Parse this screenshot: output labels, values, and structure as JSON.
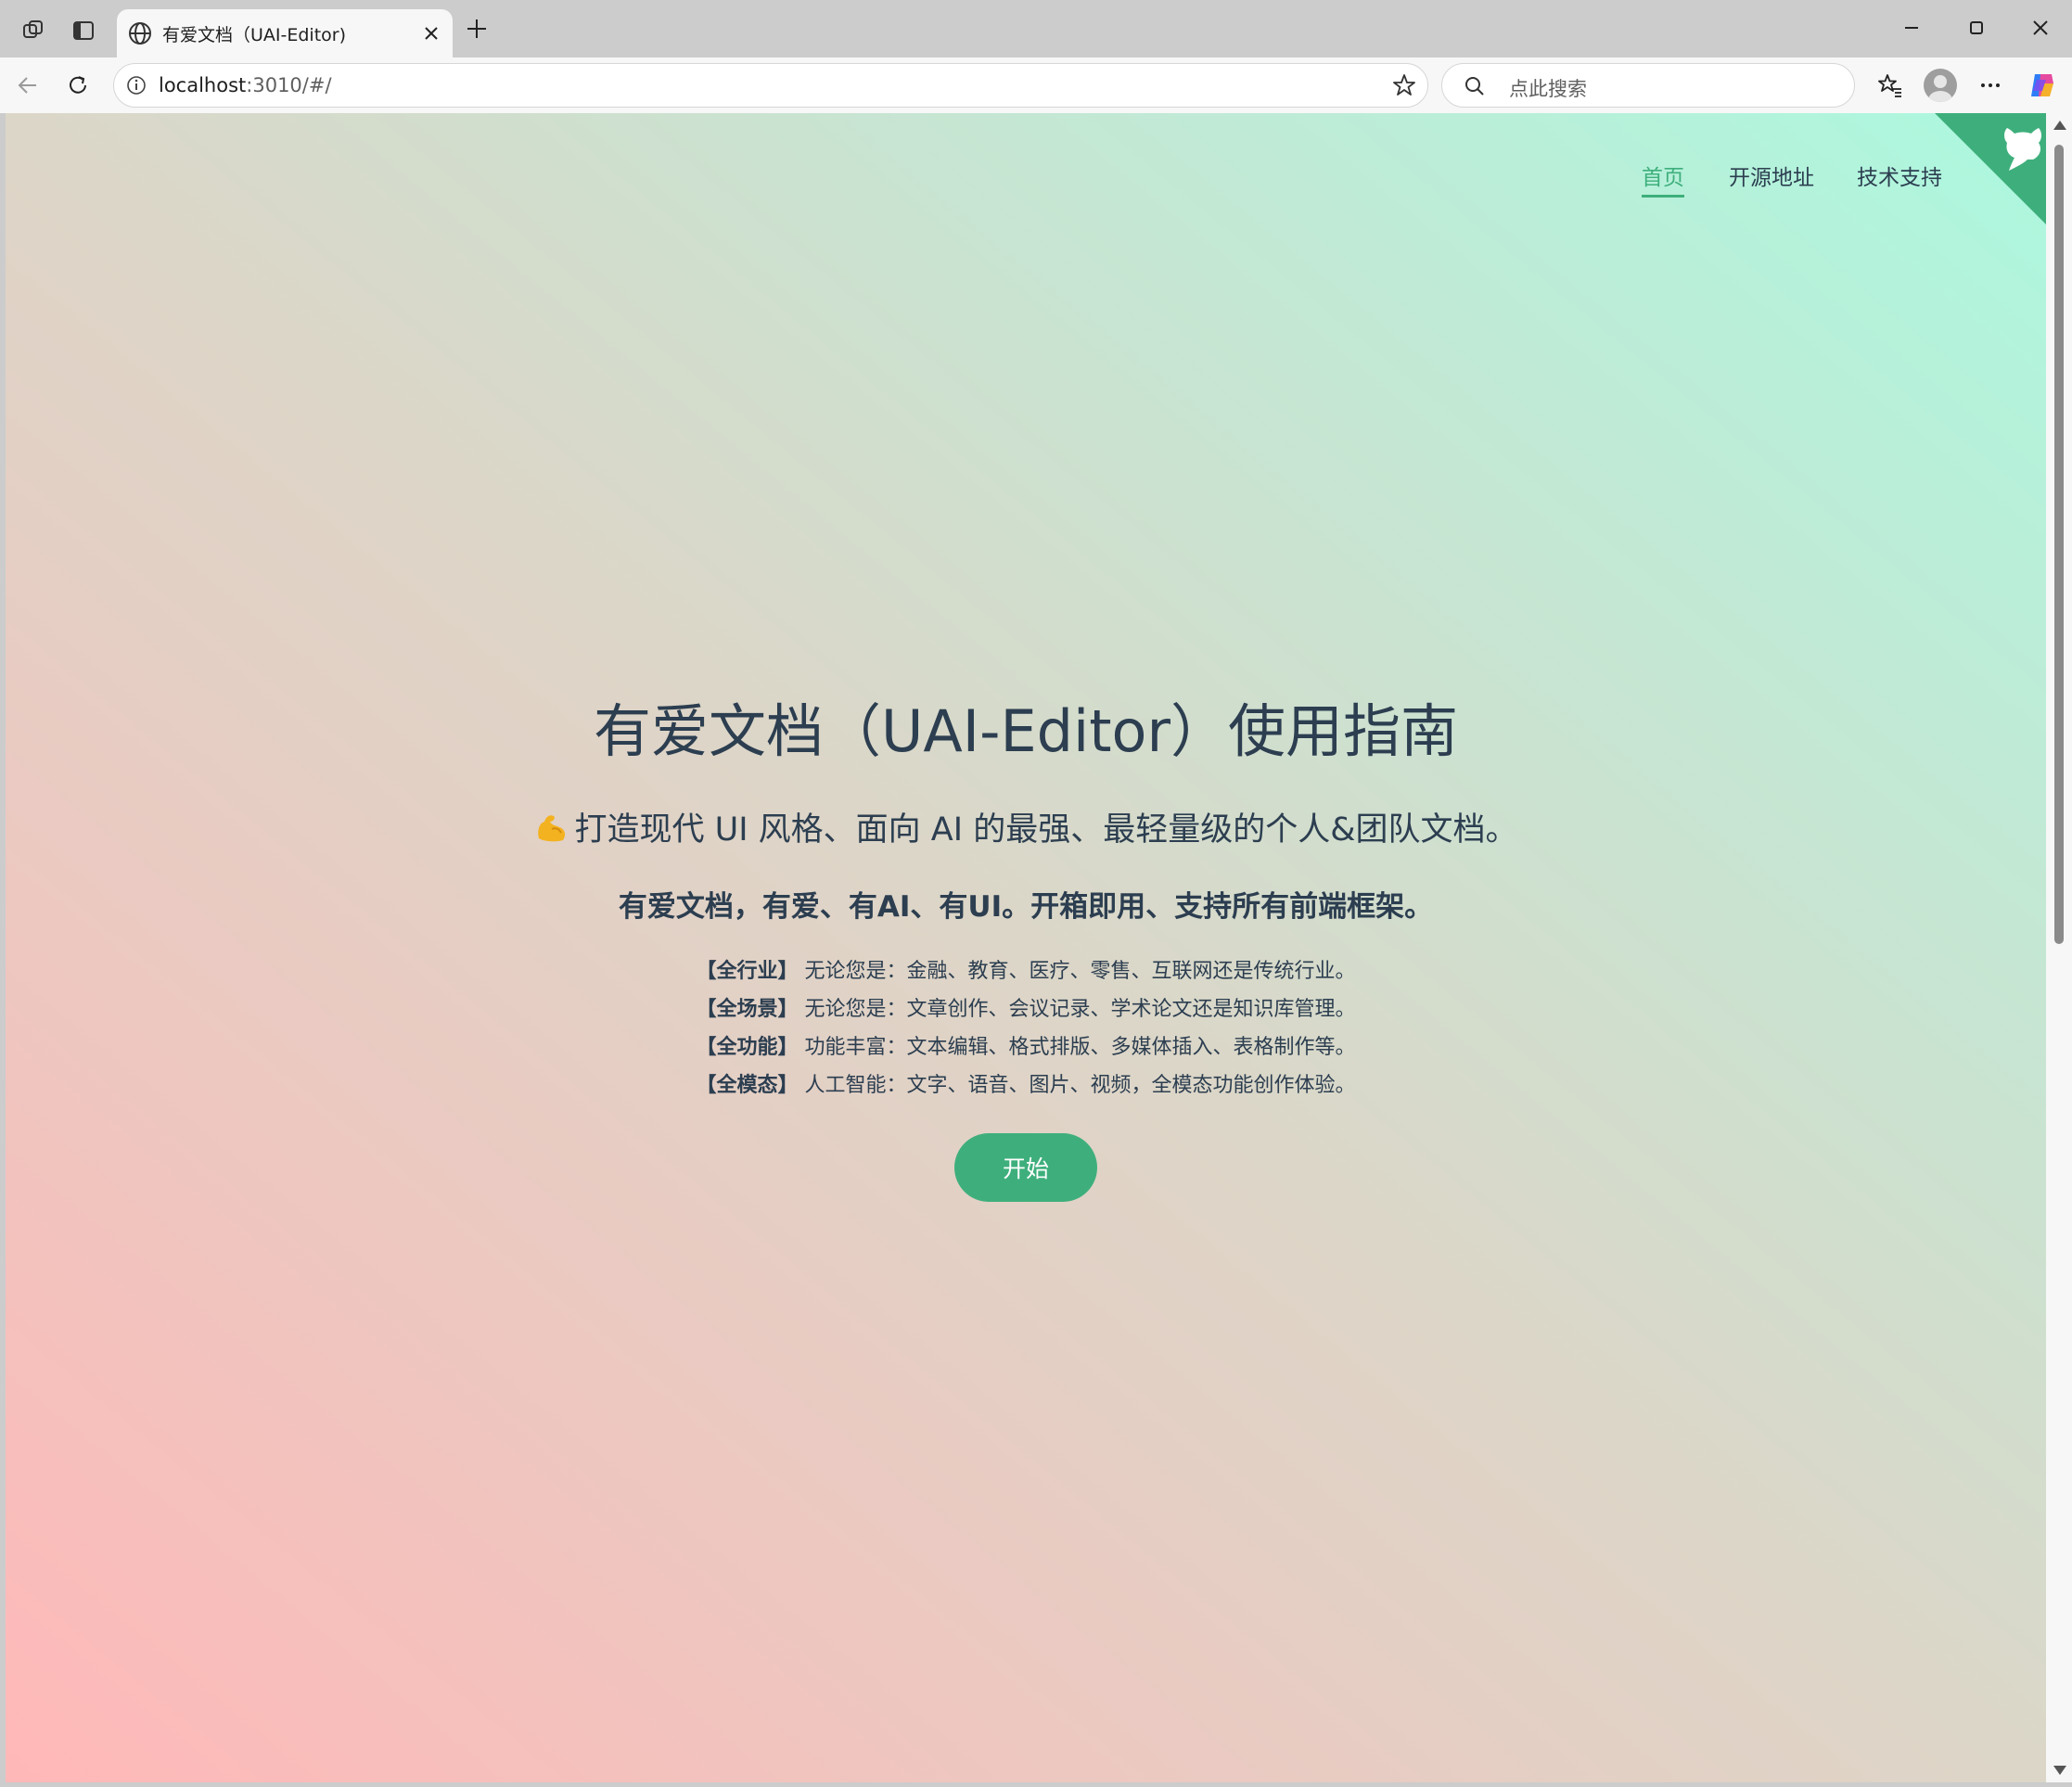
{
  "browser": {
    "tab": {
      "title": "有爱文档（UAI-Editor)",
      "icon": "globe-icon"
    },
    "address": {
      "host": "localhost",
      "path": ":3010/#/"
    },
    "search": {
      "placeholder": "点此搜索"
    }
  },
  "page": {
    "nav": {
      "home": "首页",
      "source": "开源地址",
      "support": "技术支持"
    },
    "title": "有爱文档（UAI-Editor）使用指南",
    "subtitle": "打造现代 UI 风格、面向 AI 的最强、最轻量级的个人&团队文档。",
    "tagline": "有爱文档，有爱、有AI、有UI。开箱即用、支持所有前端框架。",
    "features": [
      {
        "tag": "【全行业】",
        "text": "无论您是：金融、教育、医疗、零售、互联网还是传统行业。"
      },
      {
        "tag": "【全场景】",
        "text": "无论您是：文章创作、会议记录、学术论文还是知识库管理。"
      },
      {
        "tag": "【全功能】",
        "text": "功能丰富：文本编辑、格式排版、多媒体插入、表格制作等。"
      },
      {
        "tag": "【全模态】",
        "text": "人工智能：文字、语音、图片、视频，全模态功能创作体验。"
      }
    ],
    "start_button": "开始"
  },
  "colors": {
    "accent": "#3eaf7c",
    "text": "#2c3e50",
    "gradient_start": "#ffb8b8",
    "gradient_end": "#acf8df"
  }
}
